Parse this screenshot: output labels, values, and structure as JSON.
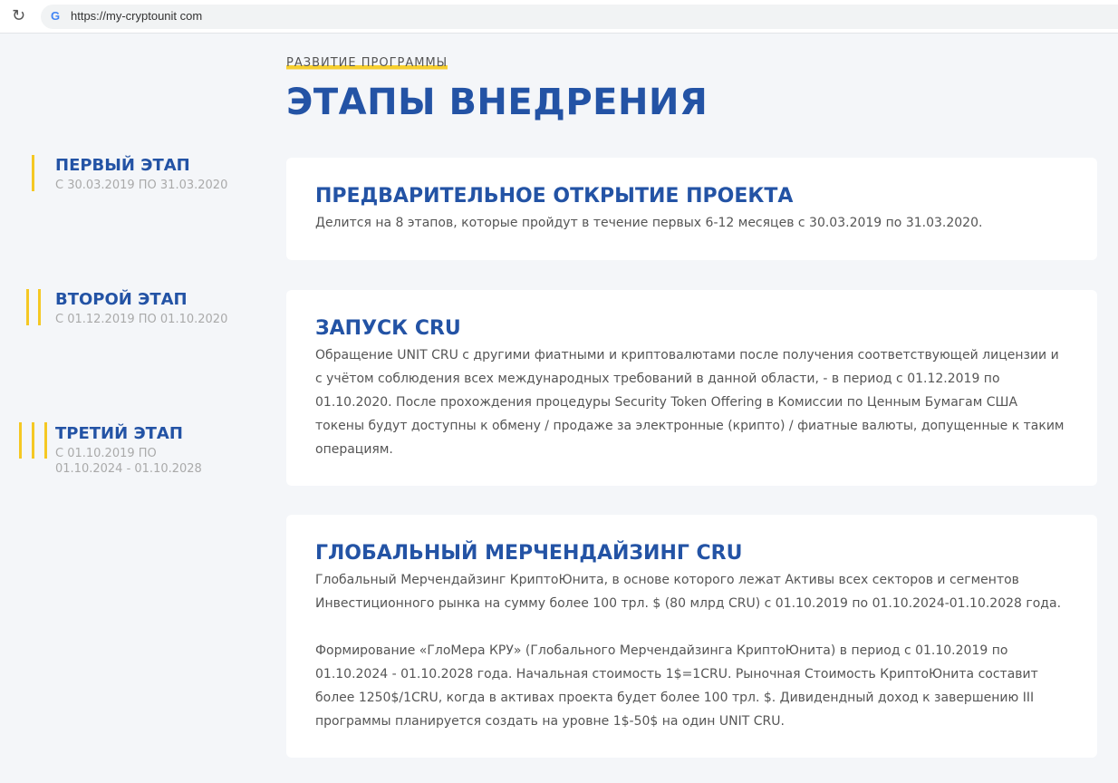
{
  "browser": {
    "url": "https://my-cryptounit com"
  },
  "header": {
    "eyebrow": "РАЗВИТИЕ ПРОГРАММЫ",
    "title": "ЭТАПЫ ВНЕДРЕНИЯ"
  },
  "stages": [
    {
      "name": "ПЕРВЫЙ ЭТАП",
      "dates": "С 30.03.2019 ПО 31.03.2020"
    },
    {
      "name": "ВТОРОЙ ЭТАП",
      "dates": "С 01.12.2019 ПО 01.10.2020"
    },
    {
      "name": "ТРЕТИЙ ЭТАП",
      "dates": "С 01.10.2019 ПО 01.10.2024 - 01.10.2028"
    }
  ],
  "cards": [
    {
      "title": "ПРЕДВАРИТЕЛЬНОЕ ОТКРЫТИЕ ПРОЕКТА",
      "paragraphs": [
        "Делится на 8 этапов, которые пройдут в течение первых 6-12 месяцев с 30.03.2019 по 31.03.2020."
      ]
    },
    {
      "title": "ЗАПУСК CRU",
      "paragraphs": [
        "Обращение UNIT CRU с другими фиатными и криптовалютами после получения соответствующей лицензии и с учётом соблюдения всех международных требований в данной области, - в период с 01.12.2019 по 01.10.2020. После прохождения процедуры Security Token Offering в Комиссии по Ценным Бумагам США токены будут доступны к обмену / продаже за электронные (крипто) / фиатные валюты, допущенные к таким операциям."
      ]
    },
    {
      "title": "ГЛОБАЛЬНЫЙ МЕРЧЕНДАЙЗИНГ CRU",
      "paragraphs": [
        "Глобальный Мерчендайзинг КриптоЮнита, в основе которого лежат Активы всех секторов и сегментов Инвестиционного рынка на сумму более 100 трл. $ (80 млрд CRU) с 01.10.2019 по 01.10.2024-01.10.2028 года.",
        "Формирование «ГлоМера КРУ» (Глобального Мерчендайзинга КриптоЮнита) в период с 01.10.2019 по 01.10.2024 - 01.10.2028 года. Начальная стоимость 1$=1CRU. Рыночная Стоимость КриптоЮнита составит более 1250$/1CRU, когда в активах проекта будет более 100 трл. $. Дивидендный доход к завершению III программы планируется создать на уровне 1$-50$ на один UNIT CRU."
      ]
    }
  ]
}
